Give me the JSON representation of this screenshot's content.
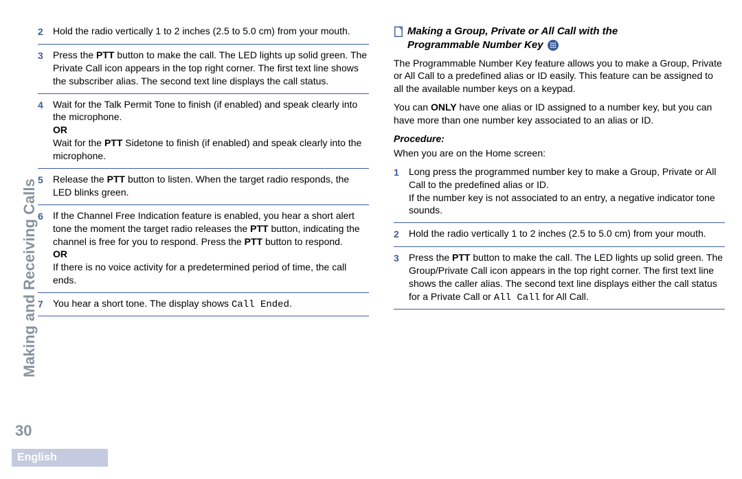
{
  "page_number": "30",
  "language": "English",
  "side_title": "Making and Receiving Calls",
  "left": {
    "s2": "Hold the radio vertically 1 to 2 inches (2.5 to 5.0 cm) from your mouth.",
    "s3_a": "Press the ",
    "PTT": "PTT",
    "s3_b": " button to make the call. The LED lights up solid green. The Private Call icon appears in the top right corner. The first text line shows the subscriber alias. The second text line displays the call status.",
    "s4_a": "Wait for the Talk Permit Tone to finish (if enabled) and speak clearly into the microphone.",
    "OR": "OR",
    "s4_b1": "Wait for the ",
    "s4_b2": " Sidetone to finish (if enabled) and speak clearly into the microphone.",
    "s5_a": "Release the ",
    "s5_b": " button to listen. When the target radio responds, the LED blinks green.",
    "s6_a": "If the Channel Free Indication feature is enabled, you hear a short alert tone the moment the target radio releases the ",
    "s6_b": " button, indicating the channel is free for you to respond. Press the ",
    "s6_c": " button to respond.",
    "s6_d": "If there is no voice activity for a predetermined period of time, the call ends.",
    "s7_a": "You hear a short tone. The display shows ",
    "call_ended": "Call Ended",
    "s7_b": "."
  },
  "right": {
    "heading1": "Making a Group, Private or All Call with the",
    "heading2": "Programmable Number Key",
    "p1": "The Programmable Number Key feature allows you to make a Group, Private or All Call to a predefined alias or ID easily. This feature can be assigned to all the available number keys on a keypad.",
    "p2a": "You can ",
    "ONLY": "ONLY",
    "p2b": " have one alias or ID assigned to a number key, but you can have more than one number key associated to an alias or ID.",
    "procedure": "Procedure:",
    "when": "When you are on the Home screen:",
    "s1a": "Long press the programmed number key to make a Group, Private or All Call to the predefined alias or ID.",
    "s1b": "If the number key is not associated to an entry, a negative indicator tone sounds.",
    "s2": "Hold the radio vertically 1 to 2 inches (2.5 to 5.0 cm) from your mouth.",
    "s3a": "Press the ",
    "PTT": "PTT",
    "s3b": " button to make the call. The LED lights up solid green. The Group/Private Call icon appears in the top right corner. The first text line shows the caller alias. The second text line displays either the call status for a Private Call or ",
    "allcall": "All Call",
    "s3c": " for All Call."
  }
}
